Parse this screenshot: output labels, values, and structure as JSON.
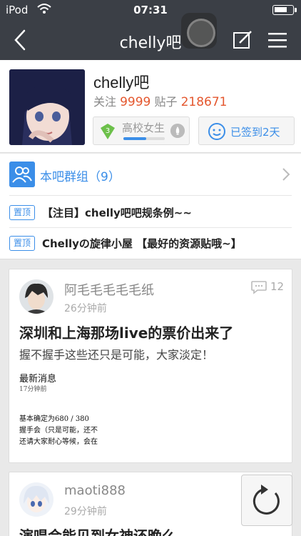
{
  "status_bar": {
    "carrier": "iPod",
    "time": "07:31",
    "battery_level": 0.75
  },
  "nav": {
    "title": "chelly吧"
  },
  "forum": {
    "name": "chelly吧",
    "follow_label": "关注",
    "follow_count": "9999",
    "posts_label": "贴子",
    "posts_count": "218671",
    "level_number": "3",
    "level_title": "高校女生",
    "level_progress": 0.55,
    "signed_text": "已签到2天"
  },
  "group": {
    "label": "本吧群组（9）"
  },
  "pinned": [
    {
      "tag": "置顶",
      "title": "【注目】chelly吧吧规条例~~"
    },
    {
      "tag": "置顶",
      "title": "Chellyの旋律小屋 【最好的资源贴哦~】"
    }
  ],
  "posts": [
    {
      "author": "阿毛毛毛毛毛纸",
      "time": "26分钟前",
      "comments": "12",
      "title": "深圳和上海那场live的票价出来了",
      "body": "握不握手这些还只是可能，大家淡定！",
      "image_lines": [
        "最新消息",
        "17分钟前",
        "基本确定为680 / 380",
        "握手会（只是可能，还不",
        "还请大家耐心等候，会在"
      ]
    },
    {
      "author": "maoti888",
      "time": "29分钟前",
      "title": "演唱会能见到女神还晚么"
    }
  ],
  "colors": {
    "accent": "#3b8ee8",
    "number": "#e4572e",
    "nav": "#3b3f46"
  }
}
